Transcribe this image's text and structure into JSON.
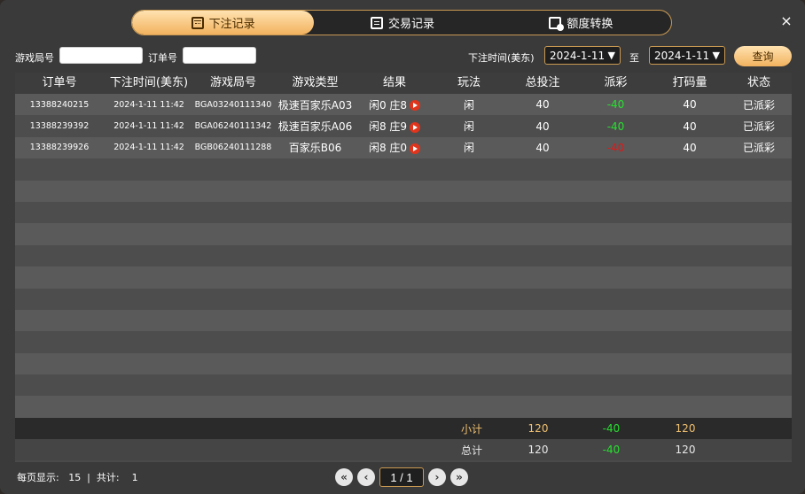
{
  "tabs": [
    {
      "label": "下注记录",
      "icon": "calendar-icon",
      "active": true
    },
    {
      "label": "交易记录",
      "icon": "clipboard-icon",
      "active": false
    },
    {
      "label": "额度转换",
      "icon": "coin-transfer-icon",
      "active": false
    }
  ],
  "close_label": "×",
  "filters": {
    "game_no_label": "游戏局号",
    "game_no_value": "",
    "order_no_label": "订单号",
    "order_no_value": "",
    "bet_time_label": "下注时间(美东)",
    "date_from": "2024-1-11",
    "to_label": "至",
    "date_to": "2024-1-11",
    "query_label": "查询"
  },
  "table": {
    "columns": [
      "订单号",
      "下注时间(美东)",
      "游戏局号",
      "游戏类型",
      "结果",
      "玩法",
      "总投注",
      "派彩",
      "打码量",
      "状态"
    ],
    "rows": [
      {
        "order": "13388240215",
        "time": "2024-1-11 11:42",
        "game_no": "BGA03240111340",
        "game_type": "极速百家乐A03",
        "result": "闲0 庄8",
        "play": "闲",
        "bet": "40",
        "payout": "-40",
        "payout_color": "green",
        "turnover": "40",
        "status": "已派彩"
      },
      {
        "order": "13388239392",
        "time": "2024-1-11 11:42",
        "game_no": "BGA06240111342",
        "game_type": "极速百家乐A06",
        "result": "闲8 庄9",
        "play": "闲",
        "bet": "40",
        "payout": "-40",
        "payout_color": "green",
        "turnover": "40",
        "status": "已派彩"
      },
      {
        "order": "13388239926",
        "time": "2024-1-11 11:42",
        "game_no": "BGB06240111288",
        "game_type": "百家乐B06",
        "result": "闲8 庄0",
        "play": "闲",
        "bet": "40",
        "payout": "-40",
        "payout_color": "red",
        "turnover": "40",
        "status": "已派彩"
      }
    ],
    "empty_rows": 12
  },
  "summary": {
    "subtotal_label": "小计",
    "subtotal_bet": "120",
    "subtotal_payout": "-40",
    "subtotal_turnover": "120",
    "total_label": "总计",
    "total_bet": "120",
    "total_payout": "-40",
    "total_turnover": "120"
  },
  "footer": {
    "page_info": "每页显示:   15  |  共计:    1",
    "page_input": "1 / 1"
  },
  "colors": {
    "accent_gold": "#f2b25e",
    "green": "#27e030",
    "red": "#e01818"
  }
}
